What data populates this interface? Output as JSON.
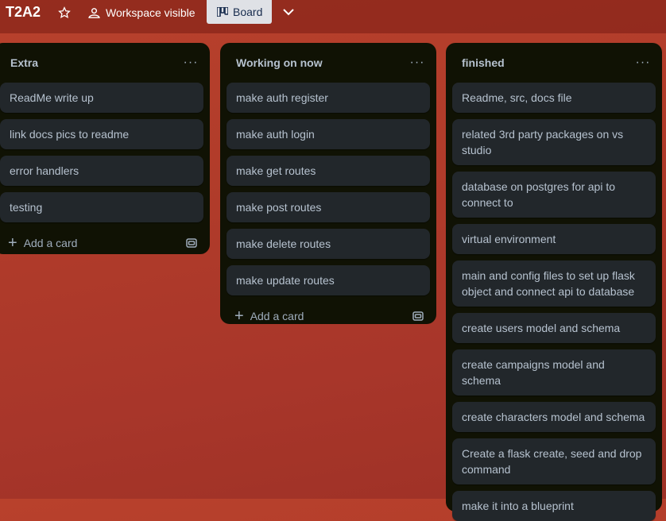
{
  "header": {
    "board_title": "T2A2",
    "star_icon": "star-icon",
    "visibility_label": "Workspace visible",
    "view_label": "Board",
    "chevron_icon": "chevron-down-icon"
  },
  "lists": [
    {
      "title": "Extra",
      "menu": "···",
      "cards": [
        "ReadMe write up",
        "link docs pics to readme",
        "error handlers",
        "testing"
      ],
      "add_label": "Add a card"
    },
    {
      "title": "Working on now",
      "menu": "···",
      "cards": [
        "make auth register",
        "make auth login",
        "make get routes",
        "make post routes",
        "make delete routes",
        "make update routes"
      ],
      "add_label": "Add a card"
    },
    {
      "title": "finished",
      "menu": "···",
      "cards": [
        "Readme, src, docs file",
        "related 3rd party packages on vs studio",
        "database on postgres for api to connect to",
        "virtual environment",
        "main and config files to set up flask object and connect api to database",
        "create users model and schema",
        "create campaigns model and schema",
        "create characters model and schema",
        "Create a flask create, seed and drop command",
        "make it into a blueprint"
      ]
    }
  ],
  "colors": {
    "board_bg": "#b03b2a",
    "list_bg": "#101204",
    "card_bg": "#22272b",
    "text": "#b6c2cf"
  }
}
